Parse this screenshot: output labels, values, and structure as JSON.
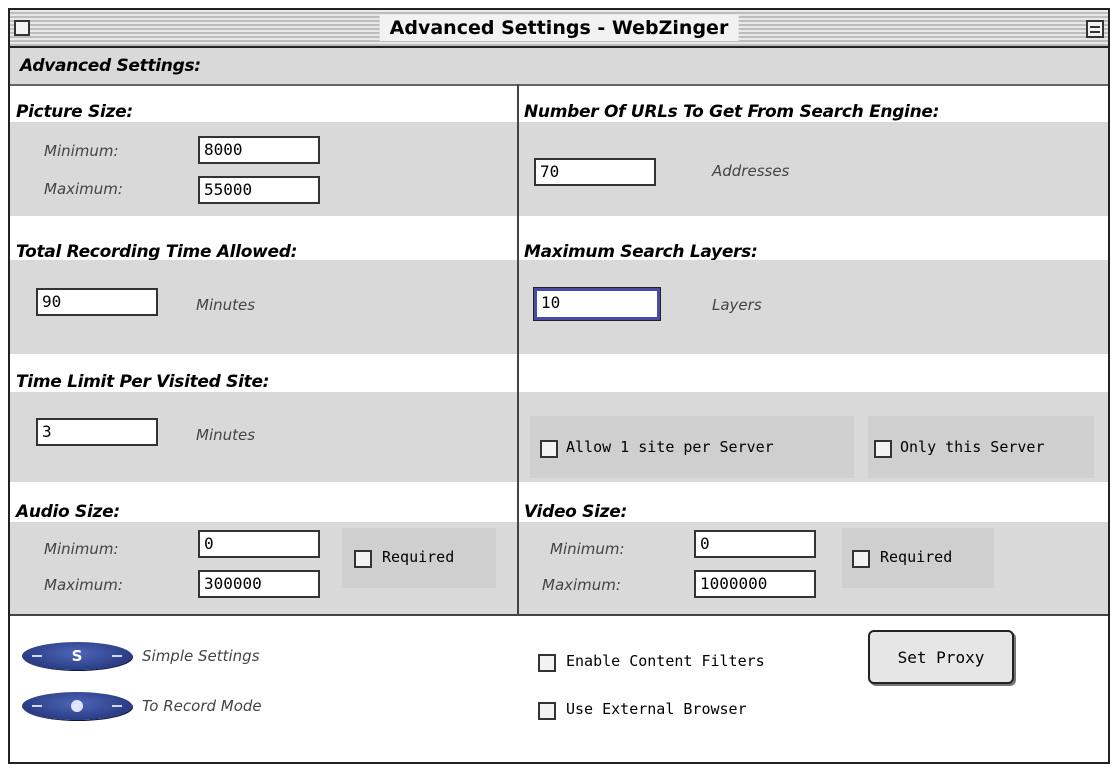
{
  "window": {
    "title": "Advanced Settings - WebZinger"
  },
  "header": {
    "title": "Advanced Settings:"
  },
  "picture_size": {
    "heading": "Picture Size:",
    "minimum_label": "Minimum:",
    "minimum_value": "8000",
    "maximum_label": "Maximum:",
    "maximum_value": "55000"
  },
  "urls": {
    "heading": "Number Of URLs To Get From Search Engine:",
    "value": "70",
    "unit": "Addresses"
  },
  "recording_time": {
    "heading": "Total Recording Time Allowed:",
    "value": "90",
    "unit": "Minutes"
  },
  "search_layers": {
    "heading": "Maximum Search Layers:",
    "value": "10",
    "unit": "Layers"
  },
  "site_time": {
    "heading": "Time Limit Per Visited Site:",
    "value": "3",
    "unit": "Minutes"
  },
  "server_options": {
    "allow_one_site_label": "Allow 1 site per Server",
    "allow_one_site_checked": false,
    "only_this_server_label": "Only this Server",
    "only_this_server_checked": false
  },
  "audio_size": {
    "heading": "Audio Size:",
    "minimum_label": "Minimum:",
    "minimum_value": "0",
    "maximum_label": "Maximum:",
    "maximum_value": "300000",
    "required_label": "Required",
    "required_checked": false
  },
  "video_size": {
    "heading": "Video Size:",
    "minimum_label": "Minimum:",
    "minimum_value": "0",
    "maximum_label": "Maximum:",
    "maximum_value": "1000000",
    "required_label": "Required",
    "required_checked": false
  },
  "footer": {
    "simple_settings_mark": "S",
    "simple_settings_label": "Simple Settings",
    "record_mode_label": "To Record Mode",
    "enable_filters_label": "Enable Content Filters",
    "enable_filters_checked": false,
    "external_browser_label": "Use External Browser",
    "external_browser_checked": false,
    "set_proxy_label": "Set Proxy"
  },
  "colors": {
    "panel_gray": "#d9d9d9",
    "pill_blue": "#2a3c8c",
    "focus_border": "#4a4aa8"
  }
}
